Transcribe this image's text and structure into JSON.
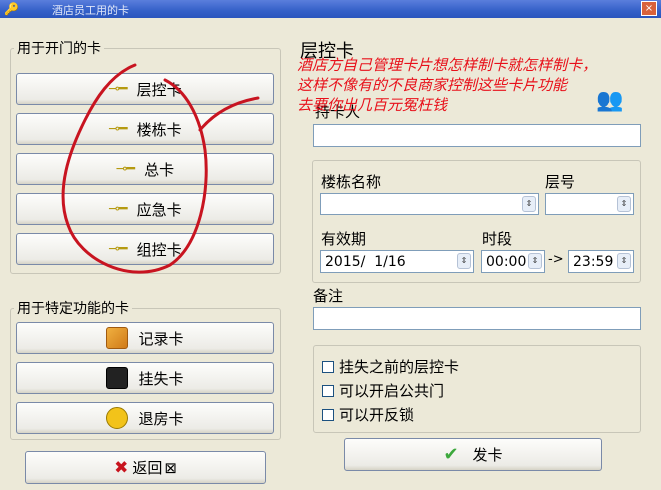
{
  "window": {
    "title": "酒店员工用的卡"
  },
  "open_cards": {
    "group_label": "用于开门的卡",
    "buttons": [
      "层控卡",
      "楼栋卡",
      "总卡",
      "应急卡",
      "组控卡"
    ]
  },
  "function_cards": {
    "group_label": "用于特定功能的卡",
    "buttons": [
      "记录卡",
      "挂失卡",
      "退房卡"
    ]
  },
  "back_button": "返回",
  "form": {
    "section_title": "层控卡",
    "holder_label": "持卡人",
    "holder_value": "",
    "building_label": "楼栋名称",
    "building_value": "",
    "floor_label": "层号",
    "floor_value": "",
    "validity_label": "有效期",
    "validity_value": "2015/  1/16",
    "time_label": "时段",
    "time_from": "00:00",
    "time_arrow": "->",
    "time_to": "23:59",
    "remark_label": "备注",
    "remark_value": "",
    "checkboxes": [
      "挂失之前的层控卡",
      "可以开启公共门",
      "可以开反锁"
    ],
    "issue_button": "发卡"
  },
  "annotation": {
    "lines": [
      "酒店方自己管理卡片想怎样制卡就怎样制卡，",
      "这样不像有的不良商家控制这些卡片功能",
      "去要你出几百元冤枉钱"
    ],
    "color": "#e8101a"
  },
  "colors": {
    "titlebar": "#3460c8",
    "face": "#ece9d8",
    "check": "#3ca83c",
    "cross": "#c8141e"
  }
}
